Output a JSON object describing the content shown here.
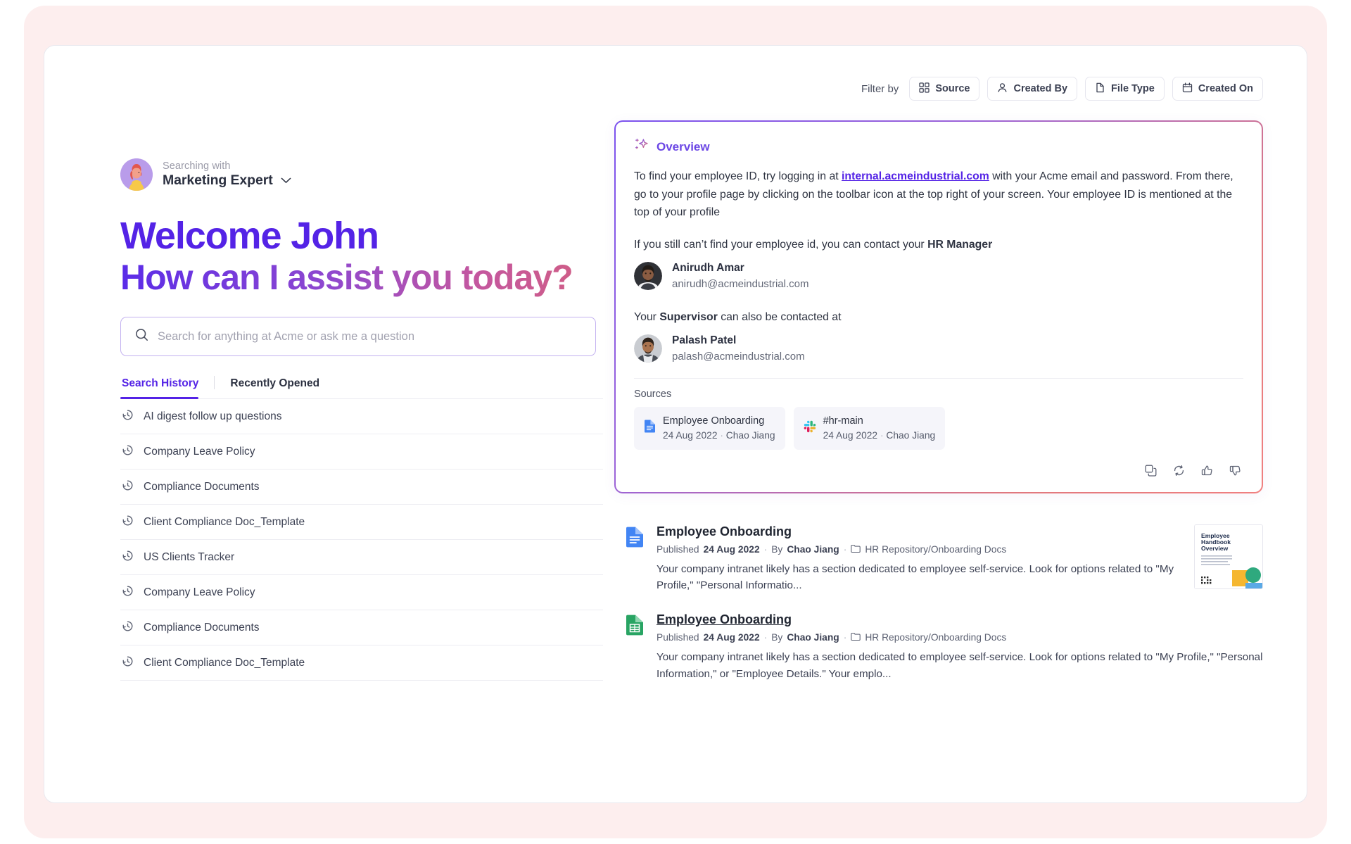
{
  "persona": {
    "label": "Searching with",
    "name": "Marketing Expert",
    "chevron_icon": "chevron-down-icon",
    "avatar_icon": "persona-avatar"
  },
  "hero": {
    "line1": "Welcome John",
    "line2": "How can I assist you today?"
  },
  "search": {
    "placeholder": "Search for anything at Acme or ask me a question",
    "value": "",
    "icon": "search-icon"
  },
  "tabs": [
    {
      "label": "Search History",
      "active": true
    },
    {
      "label": "Recently Opened",
      "active": false
    }
  ],
  "history": {
    "item_icon": "history-clock-icon",
    "items": [
      {
        "label": "AI digest follow up questions"
      },
      {
        "label": "Company Leave Policy"
      },
      {
        "label": "Compliance Documents"
      },
      {
        "label": "Client Compliance Doc_Template"
      },
      {
        "label": "US Clients Tracker"
      },
      {
        "label": "Company Leave Policy"
      },
      {
        "label": "Compliance Documents"
      },
      {
        "label": "Client Compliance Doc_Template"
      }
    ]
  },
  "filter": {
    "label": "Filter by",
    "buttons": [
      {
        "label": "Source",
        "icon": "grid-icon"
      },
      {
        "label": "Created By",
        "icon": "person-icon"
      },
      {
        "label": "File Type",
        "icon": "file-icon"
      },
      {
        "label": "Created On",
        "icon": "calendar-icon"
      }
    ]
  },
  "overview": {
    "title": "Overview",
    "sparkle_icon": "sparkle-icon",
    "para1_before_link": "To find your employee ID, try logging in at ",
    "link_text": "internal.acmeindustrial.com",
    "para1_after_link": " with your Acme email and password. From there, go to your profile page by clicking on the toolbar icon at the top right of your screen. Your employee ID is mentioned at the top of your profile",
    "para2_before": "If you still can’t find your employee id, you can contact your ",
    "para2_strong": "HR Manager",
    "para3_before": "Your ",
    "para3_strong": "Supervisor",
    "para3_after": " can also be contacted at",
    "contacts": [
      {
        "name": "Anirudh Amar",
        "email": "anirudh@acmeindustrial.com",
        "avatar_icon": "contact-avatar"
      },
      {
        "name": "Palash Patel",
        "email": "palash@acmeindustrial.com",
        "avatar_icon": "contact-avatar"
      }
    ],
    "sources_label": "Sources",
    "sources": [
      {
        "title": "Employee Onboarding",
        "date": "24 Aug 2022",
        "author": "Chao Jiang",
        "icon": "google-docs-icon"
      },
      {
        "title": "#hr-main",
        "date": "24 Aug 2022",
        "author": "Chao Jiang",
        "icon": "slack-icon"
      }
    ],
    "actions": [
      {
        "name": "copy-icon"
      },
      {
        "name": "regenerate-icon"
      },
      {
        "name": "thumbs-up-icon"
      },
      {
        "name": "thumbs-down-icon"
      }
    ]
  },
  "results": [
    {
      "title": "Employee Onboarding",
      "icon": "google-docs-icon",
      "published_label": "Published",
      "date": "24 Aug 2022",
      "by_label": "By",
      "author": "Chao Jiang",
      "path_icon": "folder-icon",
      "path": "HR Repository/Onboarding Docs",
      "snippet": "Your company intranet likely has a section dedicated to employee self-service. Look for options related to \"My Profile,\" \"Personal Informatio...",
      "underlined": false,
      "thumbnail": {
        "title_line1": "Employee",
        "title_line2": "Handbook",
        "title_line3": "Overview"
      }
    },
    {
      "title": "Employee Onboarding",
      "icon": "google-sheets-icon",
      "published_label": "Published",
      "date": "24 Aug 2022",
      "by_label": "By",
      "author": "Chao Jiang",
      "path_icon": "folder-icon",
      "path": "HR Repository/Onboarding Docs",
      "snippet": "Your company intranet likely has a section dedicated to employee self-service. Look for options related to \"My Profile,\" \"Personal Information,\" or \"Employee Details.\" Your emplo...",
      "underlined": true,
      "thumbnail": null
    }
  ],
  "colors": {
    "accent_purple": "#5423e6",
    "gradient_pink": "#d3607f",
    "frame_pink": "#fdeeee",
    "card_border_start": "#7b52ee",
    "card_border_end": "#f08080"
  }
}
